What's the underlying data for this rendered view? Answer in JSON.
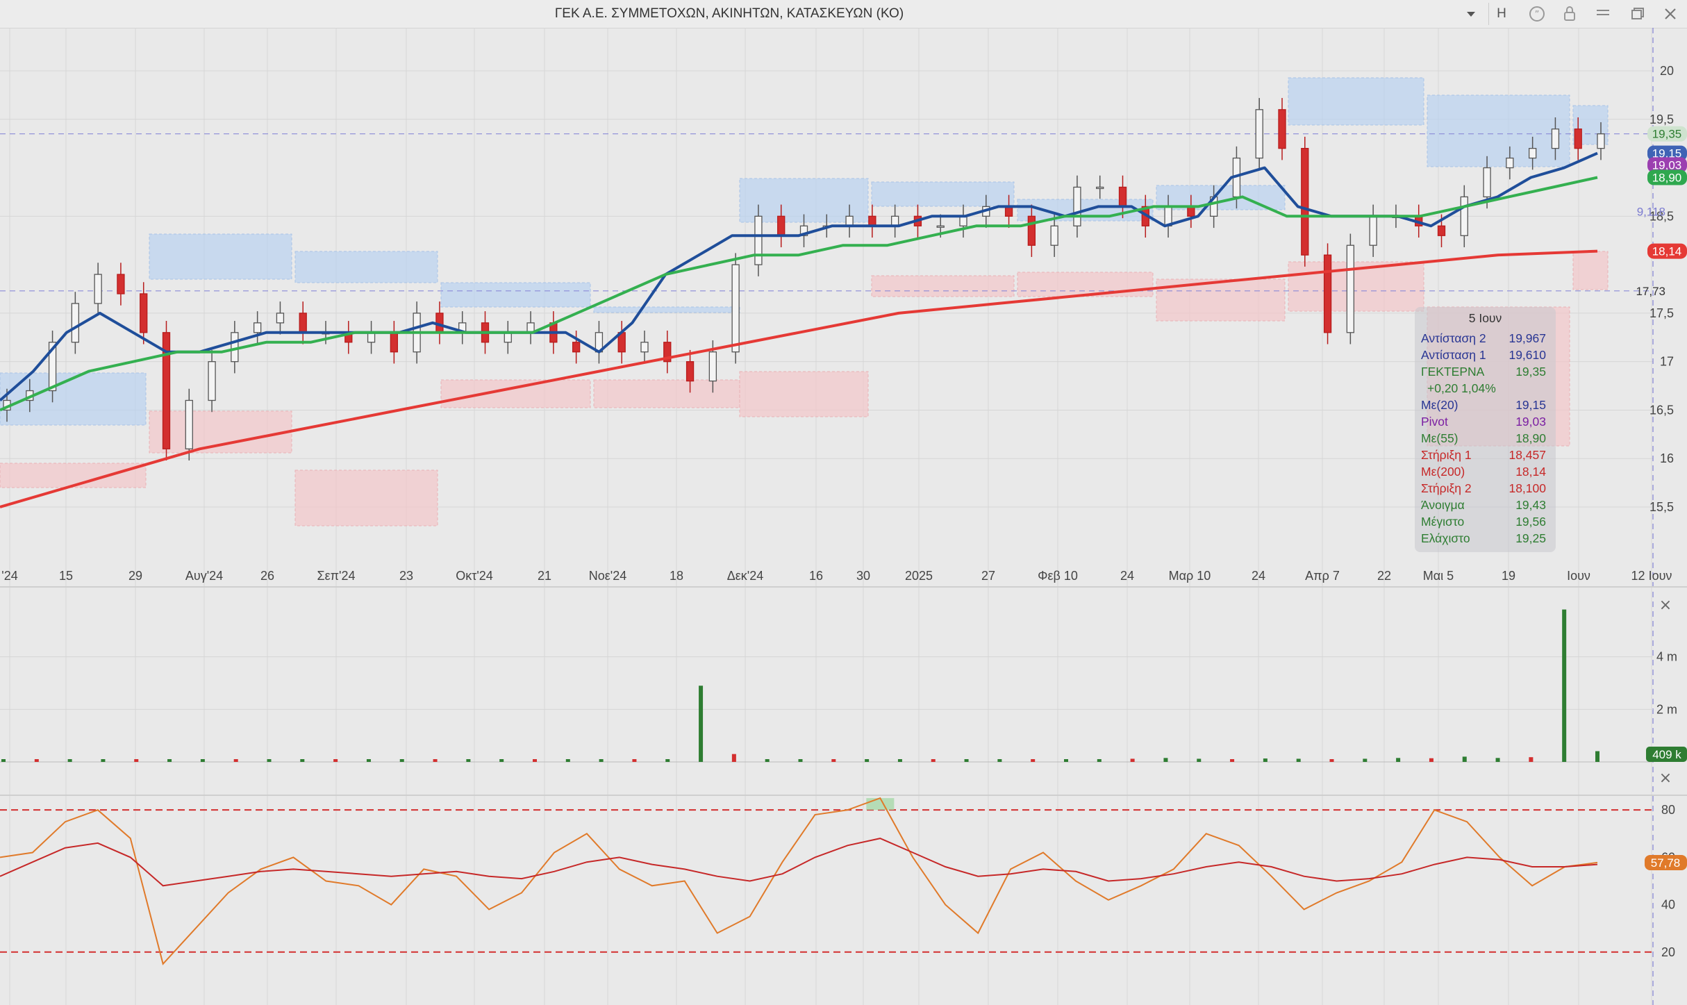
{
  "window": {
    "title": "ΓΕΚ  Α.Ε. ΣΥΜΜΕΤΟΧΩΝ, ΑΚΙΝΗΤΩΝ, ΚΑΤΑΣΚΕΥΩΝ (ΚΟ)",
    "interval_button": "H",
    "icons": [
      "chevron-down-icon",
      "quote-icon",
      "lock-icon",
      "menu-icon",
      "restore-icon",
      "close-icon"
    ]
  },
  "price_axis": {
    "ticks": [
      "20",
      "19,5",
      "18,5",
      "17,5",
      "17",
      "16,5",
      "16",
      "15,5"
    ],
    "ymin": 15.5,
    "ymax": 20.0,
    "markers": [
      {
        "label": "19,35",
        "color": "#cfe3cf",
        "text_color": "#2e7d32",
        "value": 19.35
      },
      {
        "label": "19,15",
        "color": "#3f63b5",
        "text_color": "#ffffff",
        "value": 19.15
      },
      {
        "label": "19,03",
        "color": "#9b3fb0",
        "text_color": "#ffffff",
        "value": 19.03
      },
      {
        "label": "18,90",
        "color": "#2fa84f",
        "text_color": "#ffffff",
        "value": 18.9
      },
      {
        "label": "18,14",
        "color": "#e53935",
        "text_color": "#ffffff",
        "value": 18.14
      }
    ],
    "line_labels": [
      {
        "label": "9,118",
        "value": 18.55
      },
      {
        "label": "17,73",
        "value": 17.73
      }
    ]
  },
  "time_axis": {
    "labels": [
      "'24",
      "15",
      "29",
      "Αυγ'24",
      "26",
      "Σεπ'24",
      "23",
      "Οκτ'24",
      "21",
      "Νοε'24",
      "18",
      "Δεκ'24",
      "16",
      "30",
      "2025",
      "27",
      "Φεβ 10",
      "24",
      "Μαρ 10",
      "24",
      "Απρ 7",
      "22",
      "Μαι 5",
      "19",
      "Ιουν",
      "12 Ιουν"
    ]
  },
  "info_panel": {
    "date": "5 Ιουν",
    "change": "+0,20 1,04%",
    "rows": [
      {
        "label": "Αντίσταση 2",
        "value": "19,967",
        "color": "#283593"
      },
      {
        "label": "Αντίσταση 1",
        "value": "19,610",
        "color": "#283593"
      },
      {
        "label": "ΓΕΚΤΕΡΝΑ",
        "value": "19,35",
        "color": "#2e7d32"
      },
      {
        "label": "Με(20)",
        "value": "19,15",
        "color": "#283593"
      },
      {
        "label": "Pivot",
        "value": "19,03",
        "color": "#7b1fa2"
      },
      {
        "label": "Με(55)",
        "value": "18,90",
        "color": "#2e7d32"
      },
      {
        "label": "Στήριξη 1",
        "value": "18,457",
        "color": "#c62828"
      },
      {
        "label": "Με(200)",
        "value": "18,14",
        "color": "#c62828"
      },
      {
        "label": "Στήριξη 2",
        "value": "18,100",
        "color": "#c62828"
      },
      {
        "label": "Άνοιγμα",
        "value": "19,43",
        "color": "#2e7d32"
      },
      {
        "label": "Μέγιστο",
        "value": "19,56",
        "color": "#2e7d32"
      },
      {
        "label": "Ελάχιστο",
        "value": "19,25",
        "color": "#2e7d32"
      }
    ]
  },
  "volume_pane": {
    "ticks": [
      "4 m",
      "2 m"
    ],
    "last_label": "409 k",
    "close_icon": "close-icon"
  },
  "oscillator_pane": {
    "ticks": [
      "80",
      "60",
      "40",
      "20"
    ],
    "last_label": "57,78",
    "upper_level": 80,
    "lower_level": 20,
    "close_icon": "close-icon"
  },
  "colors": {
    "up": "#2e7d32",
    "down": "#d32f2f",
    "ma20": "#1f4e9a",
    "ma55": "#34b050",
    "ma200": "#e53935",
    "oscillator": "#e07a2a",
    "oscillator_signal": "#c62828"
  },
  "chart_data": {
    "type": "line",
    "title": "ΓΕΚ  Α.Ε. ΣΥΜΜΕΤΟΧΩΝ, ΑΚΙΝΗΤΩΝ, ΚΑΤΑΣΚΕΥΩΝ (ΚΟ)",
    "x_range": [
      "2024-07",
      "2025-06-12"
    ],
    "y_range": [
      15.5,
      20.0
    ],
    "series": [
      {
        "name": "ΓΕΚΤΕΡΝΑ",
        "values": [
          16.6,
          16.7,
          17.2,
          17.6,
          17.9,
          17.7,
          17.3,
          16.1,
          16.6,
          17.0,
          17.3,
          17.4,
          17.5,
          17.3,
          17.3,
          17.2,
          17.3,
          17.1,
          17.5,
          17.3,
          17.4,
          17.2,
          17.3,
          17.4,
          17.2,
          17.1,
          17.3,
          17.1,
          17.2,
          17.0,
          16.8,
          17.1,
          18.0,
          18.5,
          18.3,
          18.4,
          18.4,
          18.5,
          18.4,
          18.5,
          18.4,
          18.4,
          18.5,
          18.6,
          18.5,
          18.2,
          18.4,
          18.8,
          18.8,
          18.6,
          18.4,
          18.6,
          18.5,
          18.7,
          19.1,
          19.6,
          19.2,
          18.1,
          17.3,
          18.2,
          18.5,
          18.5,
          18.4,
          18.3,
          18.7,
          19.0,
          19.1,
          19.2,
          19.4,
          19.2,
          19.35
        ]
      },
      {
        "name": "Με(20)",
        "values": [
          16.6,
          16.9,
          17.3,
          17.5,
          17.3,
          17.1,
          17.1,
          17.2,
          17.3,
          17.3,
          17.3,
          17.3,
          17.3,
          17.4,
          17.3,
          17.3,
          17.3,
          17.3,
          17.1,
          17.4,
          17.9,
          18.1,
          18.3,
          18.3,
          18.3,
          18.4,
          18.4,
          18.4,
          18.5,
          18.5,
          18.6,
          18.6,
          18.5,
          18.6,
          18.6,
          18.4,
          18.5,
          18.9,
          19.0,
          18.6,
          18.5,
          18.5,
          18.5,
          18.4,
          18.6,
          18.7,
          18.9,
          19.0,
          19.15
        ]
      },
      {
        "name": "Με(55)",
        "values": [
          16.5,
          16.7,
          16.9,
          17.0,
          17.1,
          17.1,
          17.2,
          17.2,
          17.3,
          17.3,
          17.3,
          17.3,
          17.3,
          17.5,
          17.7,
          17.9,
          18.0,
          18.1,
          18.1,
          18.2,
          18.2,
          18.3,
          18.4,
          18.4,
          18.5,
          18.5,
          18.6,
          18.6,
          18.7,
          18.5,
          18.5,
          18.5,
          18.5,
          18.6,
          18.7,
          18.8,
          18.9
        ]
      },
      {
        "name": "Με(200)",
        "values": [
          15.5,
          15.8,
          16.1,
          16.3,
          16.5,
          16.7,
          16.9,
          17.1,
          17.3,
          17.5,
          17.6,
          17.7,
          17.8,
          17.9,
          18.0,
          18.1,
          18.14
        ]
      }
    ],
    "levels": [
      {
        "name": "Αντίσταση 2",
        "value": 19.967
      },
      {
        "name": "Αντίσταση 1",
        "value": 19.61
      },
      {
        "name": "Pivot",
        "value": 19.03
      },
      {
        "name": "Στήριξη 1",
        "value": 18.457
      },
      {
        "name": "Στήριξη 2",
        "value": 18.1
      }
    ],
    "volume": {
      "ticks": [
        "4 m",
        "2 m"
      ],
      "values_m": [
        0.05,
        0.08,
        0.06,
        0.05,
        0.1,
        0.07,
        0.06,
        0.08,
        0.05,
        0.07,
        0.06,
        0.05,
        0.08,
        0.06,
        0.07,
        0.05,
        0.06,
        0.1,
        0.08,
        0.06,
        0.07,
        2.9,
        0.3,
        0.1,
        0.08,
        0.07,
        0.06,
        0.08,
        0.1,
        0.07,
        0.06,
        0.08,
        0.09,
        0.1,
        0.12,
        0.15,
        0.12,
        0.1,
        0.13,
        0.12,
        0.1,
        0.12,
        0.15,
        0.14,
        0.2,
        0.15,
        0.18,
        5.8,
        0.409
      ],
      "last": "409 k"
    },
    "oscillator": {
      "levels": [
        80,
        20
      ],
      "values": [
        60,
        62,
        75,
        80,
        68,
        15,
        30,
        45,
        55,
        60,
        50,
        48,
        40,
        55,
        52,
        38,
        45,
        62,
        70,
        55,
        48,
        50,
        28,
        35,
        58,
        78,
        80,
        85,
        60,
        40,
        28,
        55,
        62,
        50,
        42,
        48,
        55,
        70,
        65,
        52,
        38,
        45,
        50,
        58,
        80,
        75,
        60,
        48,
        56,
        57.78
      ],
      "signal": [
        52,
        58,
        64,
        66,
        60,
        48,
        50,
        52,
        54,
        55,
        54,
        53,
        52,
        53,
        54,
        52,
        51,
        54,
        58,
        60,
        57,
        55,
        52,
        50,
        53,
        60,
        65,
        68,
        62,
        56,
        52,
        53,
        55,
        54,
        50,
        51,
        53,
        56,
        58,
        56,
        52,
        50,
        51,
        53,
        57,
        60,
        59,
        56,
        56,
        57
      ]
    }
  }
}
